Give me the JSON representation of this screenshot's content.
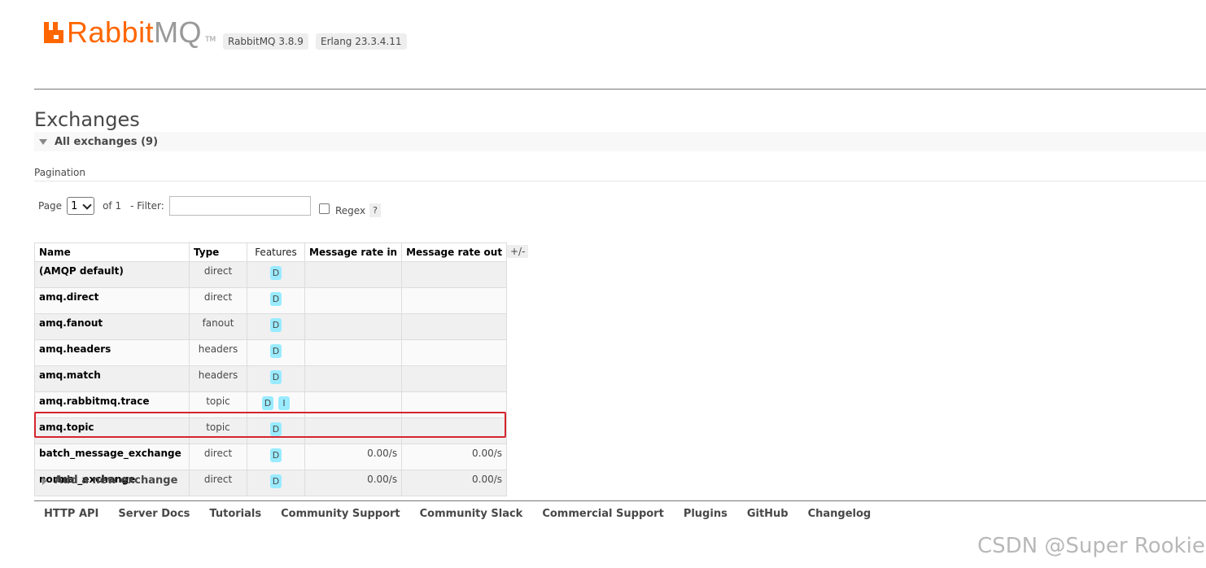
{
  "header": {
    "logo_icon": "rabbit-logo-icon",
    "logo_rabbit": "Rabbit",
    "logo_mq": "MQ",
    "logo_tm": "TM",
    "version": "RabbitMQ 3.8.9",
    "erlang": "Erlang 23.3.4.11",
    "brand_color": "#ff6600"
  },
  "page": {
    "title": "Exchanges",
    "section_label": "All exchanges (9)"
  },
  "pagination": {
    "label": "Pagination",
    "page_label": "Page",
    "page_value": "1",
    "of_label": "of 1",
    "filter_label": "- Filter:",
    "filter_value": "",
    "regex_label": "Regex",
    "help": "?"
  },
  "table": {
    "columns": [
      "Name",
      "Type",
      "Features",
      "Message rate in",
      "Message rate out"
    ],
    "toggle": "+/-",
    "rows": [
      {
        "name": "(AMQP default)",
        "type": "direct",
        "features": [
          "D"
        ],
        "rate_in": "",
        "rate_out": ""
      },
      {
        "name": "amq.direct",
        "type": "direct",
        "features": [
          "D"
        ],
        "rate_in": "",
        "rate_out": ""
      },
      {
        "name": "amq.fanout",
        "type": "fanout",
        "features": [
          "D"
        ],
        "rate_in": "",
        "rate_out": ""
      },
      {
        "name": "amq.headers",
        "type": "headers",
        "features": [
          "D"
        ],
        "rate_in": "",
        "rate_out": ""
      },
      {
        "name": "amq.match",
        "type": "headers",
        "features": [
          "D"
        ],
        "rate_in": "",
        "rate_out": ""
      },
      {
        "name": "amq.rabbitmq.trace",
        "type": "topic",
        "features": [
          "D",
          "I"
        ],
        "rate_in": "",
        "rate_out": ""
      },
      {
        "name": "amq.topic",
        "type": "topic",
        "features": [
          "D"
        ],
        "rate_in": "",
        "rate_out": ""
      },
      {
        "name": "batch_message_exchange",
        "type": "direct",
        "features": [
          "D"
        ],
        "rate_in": "0.00/s",
        "rate_out": "0.00/s"
      },
      {
        "name": "normal_exchange",
        "type": "direct",
        "features": [
          "D"
        ],
        "rate_in": "0.00/s",
        "rate_out": "0.00/s"
      }
    ],
    "highlight_color": "#d5252e"
  },
  "add_exchange": "Add a new exchange",
  "footer": {
    "links": [
      "HTTP API",
      "Server Docs",
      "Tutorials",
      "Community Support",
      "Community Slack",
      "Commercial Support",
      "Plugins",
      "GitHub",
      "Changelog"
    ]
  },
  "watermark": "CSDN @Super Rookie"
}
